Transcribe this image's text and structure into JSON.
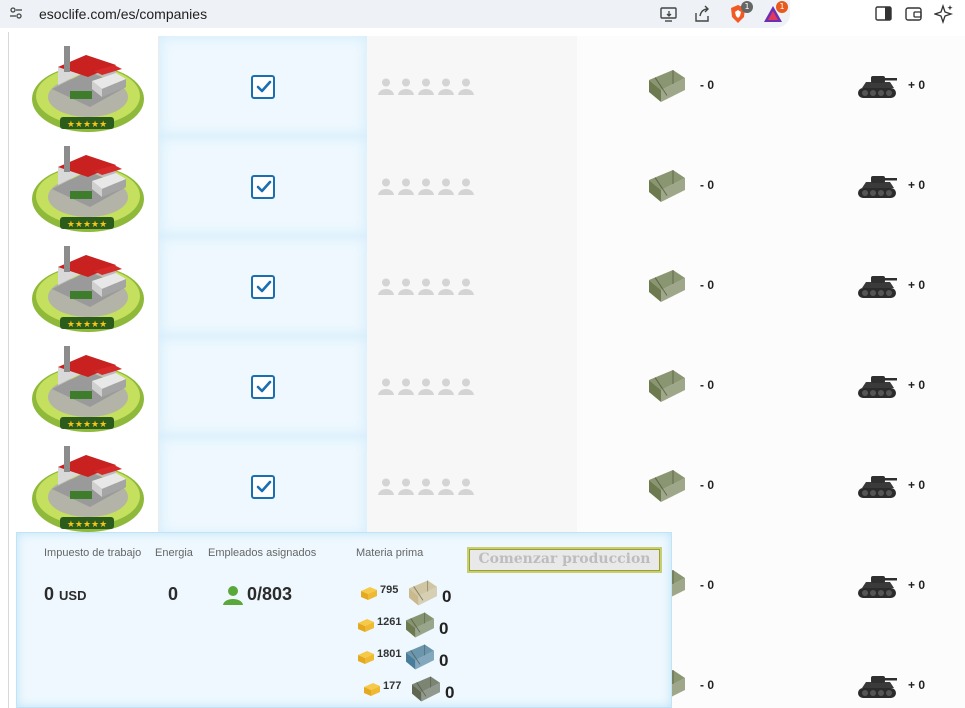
{
  "browser": {
    "url": "esoclife.com/es/companies",
    "brave_badge": "1",
    "rewards_badge": "1"
  },
  "rows": [
    {
      "crate_value": "- 0",
      "tank_value": "+ 0"
    },
    {
      "crate_value": "- 0",
      "tank_value": "+ 0"
    },
    {
      "crate_value": "- 0",
      "tank_value": "+ 0"
    },
    {
      "crate_value": "- 0",
      "tank_value": "+ 0"
    },
    {
      "crate_value": "- 0",
      "tank_value": "+ 0"
    },
    {
      "crate_value": "- 0",
      "tank_value": "+ 0"
    },
    {
      "crate_value": "- 0",
      "tank_value": "+ 0"
    }
  ],
  "panel": {
    "labels": {
      "tax": "Impuesto de trabajo",
      "energy": "Energia",
      "employees": "Empleados asignados",
      "materials": "Materia prima"
    },
    "tax_value": "0",
    "tax_unit": "USD",
    "energy_value": "0",
    "employees_value": "0/803",
    "start_button": "Comenzar produccion",
    "materials": [
      {
        "qty": "795",
        "count": "0",
        "color": "#c9b98c"
      },
      {
        "qty": "1261",
        "count": "0",
        "color": "#6d7a4f"
      },
      {
        "qty": "1801",
        "count": "0",
        "color": "#4a7d9a"
      },
      {
        "qty": "177",
        "count": "0",
        "color": "#5f6651"
      }
    ]
  },
  "colors": {
    "accent_blue": "#1a6fb0",
    "panel_bg": "#eef8fe",
    "crate_green": "#6d7a4f"
  }
}
